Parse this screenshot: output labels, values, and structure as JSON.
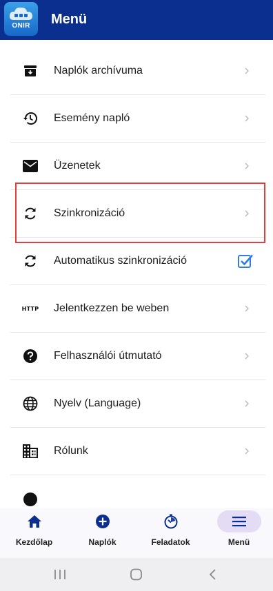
{
  "app_bar": {
    "logo_text": "ONIR",
    "title": "Menü"
  },
  "menu": {
    "items": [
      {
        "label": "Naplók archívuma",
        "icon": "archive-icon",
        "trailing": "chevron"
      },
      {
        "label": "Esemény napló",
        "icon": "history-icon",
        "trailing": "chevron"
      },
      {
        "label": "Üzenetek",
        "icon": "mail-icon",
        "trailing": "chevron"
      },
      {
        "label": "Szinkronizáció",
        "icon": "sync-icon",
        "trailing": "chevron"
      },
      {
        "label": "Automatikus szinkronizáció",
        "icon": "sync-icon",
        "trailing": "checkbox",
        "checked": true
      },
      {
        "label": "Jelentkezzen be weben",
        "icon": "http-icon",
        "icon_text": "HTTP",
        "trailing": "chevron"
      },
      {
        "label": "Felhasználói útmutató",
        "icon": "help-icon",
        "trailing": "chevron"
      },
      {
        "label": "Nyelv (Language)",
        "icon": "globe-icon",
        "trailing": "chevron"
      },
      {
        "label": "Rólunk",
        "icon": "building-icon",
        "trailing": "chevron"
      }
    ]
  },
  "bottom_nav": {
    "items": [
      {
        "label": "Kezdőlap",
        "icon": "home-icon",
        "active": false
      },
      {
        "label": "Naplók",
        "icon": "add-circle-icon",
        "active": false
      },
      {
        "label": "Feladatok",
        "icon": "timer-icon",
        "active": false
      },
      {
        "label": "Menü",
        "icon": "menu-icon",
        "active": true
      }
    ]
  },
  "colors": {
    "app_bar": "#0a2f8f",
    "accent": "#2f7de1",
    "highlight": "#e53c3c",
    "nav_active_pill": "#e4dcf5"
  }
}
